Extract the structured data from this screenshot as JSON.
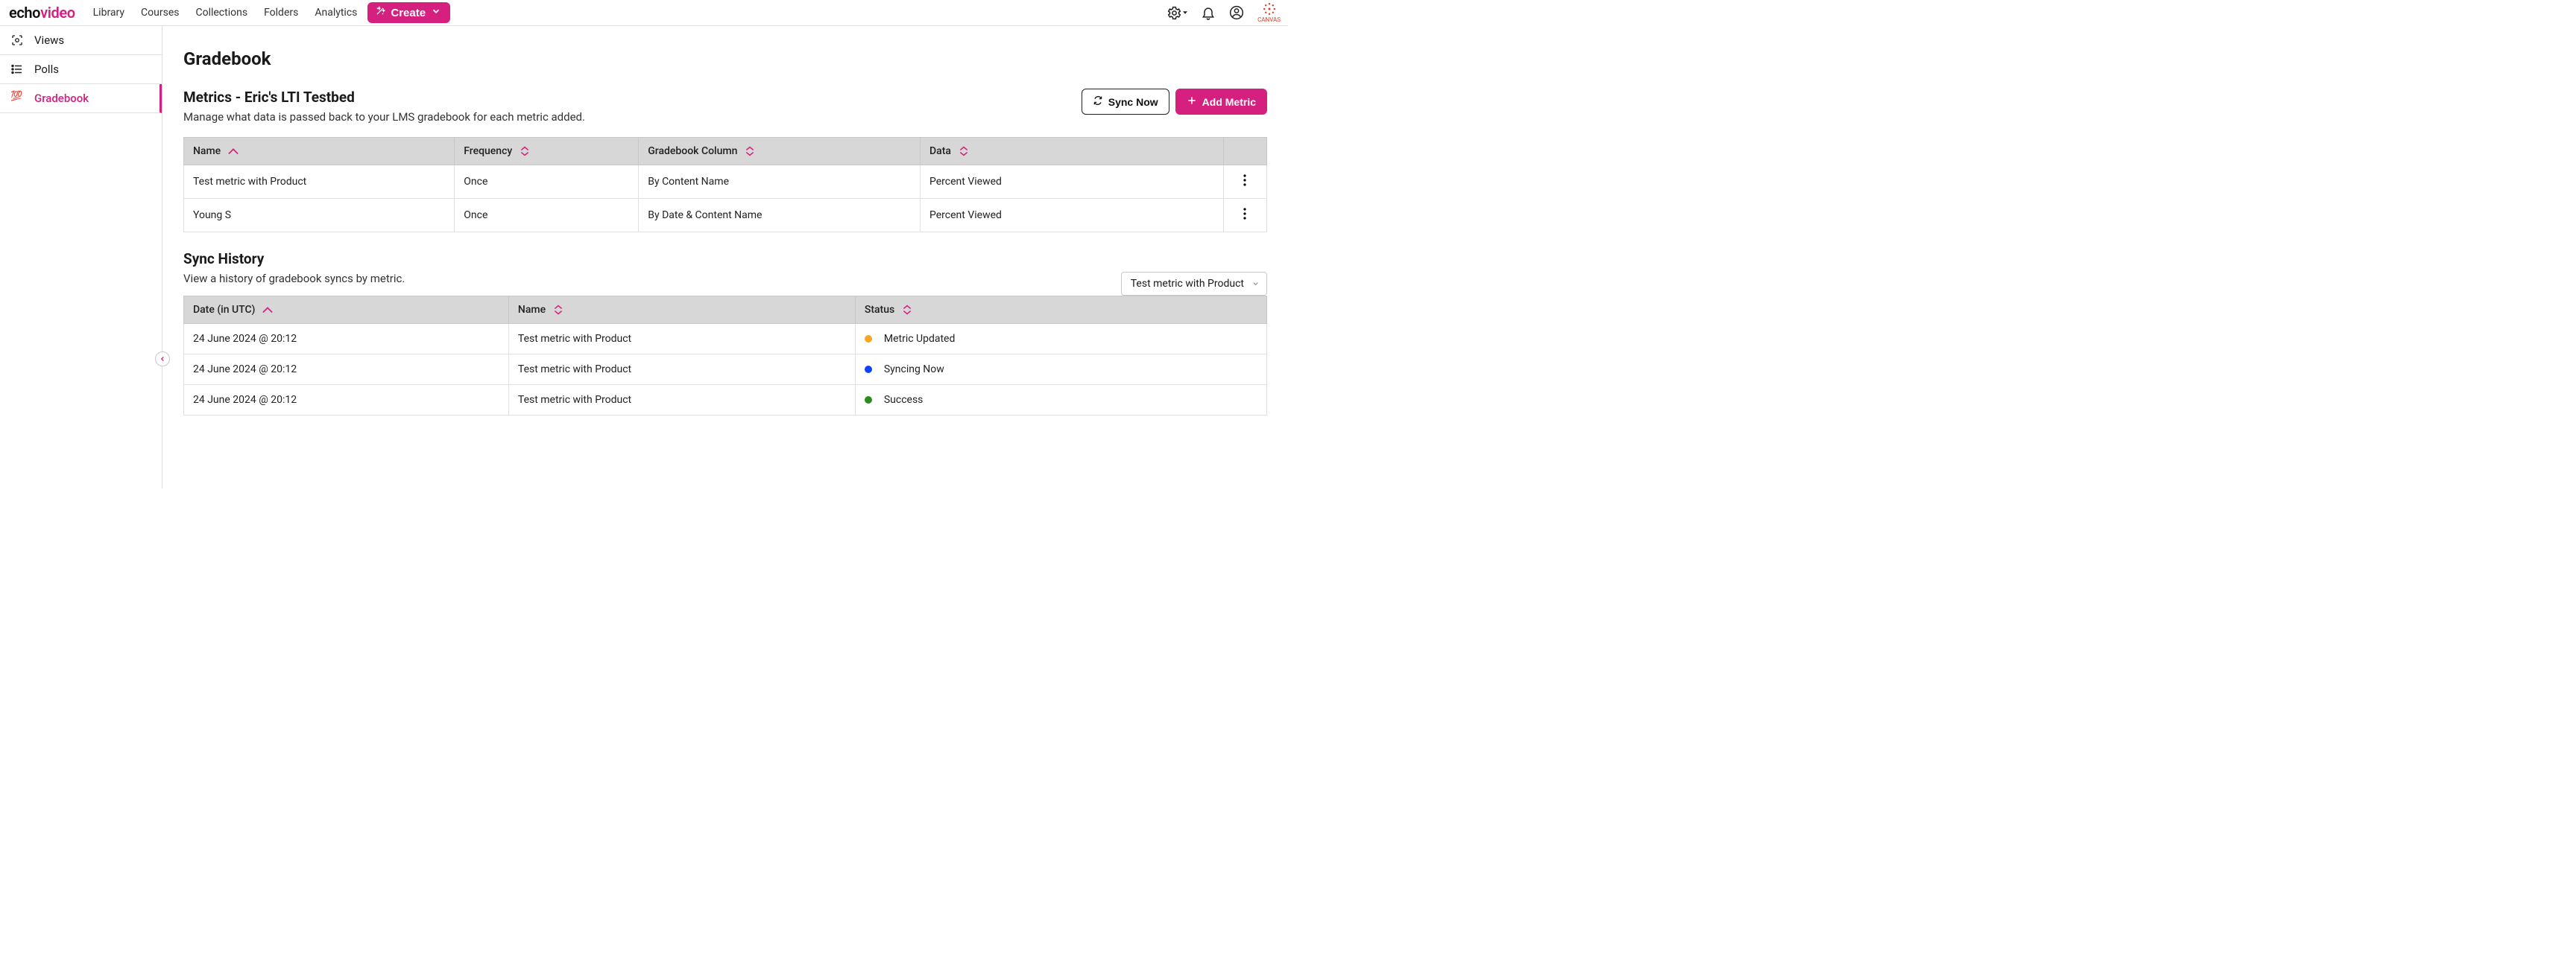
{
  "brand": {
    "part1": "echo",
    "part2": "video"
  },
  "nav": [
    "Library",
    "Courses",
    "Collections",
    "Folders",
    "Analytics"
  ],
  "create_label": "Create",
  "integration_name": "CANVAS",
  "sidebar": [
    {
      "id": "views",
      "label": "Views"
    },
    {
      "id": "polls",
      "label": "Polls"
    },
    {
      "id": "gradebook",
      "label": "Gradebook",
      "active": true
    }
  ],
  "page_title": "Gradebook",
  "metrics": {
    "heading": "Metrics - Eric's LTI Testbed",
    "description": "Manage what data is passed back to your LMS gradebook for each metric added.",
    "sync_now_label": "Sync Now",
    "add_metric_label": "Add Metric",
    "columns": [
      "Name",
      "Frequency",
      "Gradebook Column",
      "Data"
    ],
    "rows": [
      {
        "name": "Test metric with Product",
        "frequency": "Once",
        "column": "By Content Name",
        "data": "Percent Viewed"
      },
      {
        "name": "Young S",
        "frequency": "Once",
        "column": "By Date & Content Name",
        "data": "Percent Viewed"
      }
    ]
  },
  "sync": {
    "heading": "Sync History",
    "description": "View a history of gradebook syncs by metric.",
    "filter_selected": "Test metric with Product",
    "columns": [
      "Date (in UTC)",
      "Name",
      "Status"
    ],
    "rows": [
      {
        "date": "24 June 2024 @ 20:12",
        "name": "Test metric with Product",
        "status": "Metric Updated",
        "color": "#f5a623"
      },
      {
        "date": "24 June 2024 @ 20:12",
        "name": "Test metric with Product",
        "status": "Syncing Now",
        "color": "#0b44ff"
      },
      {
        "date": "24 June 2024 @ 20:12",
        "name": "Test metric with Product",
        "status": "Success",
        "color": "#2e8b1f"
      }
    ]
  }
}
